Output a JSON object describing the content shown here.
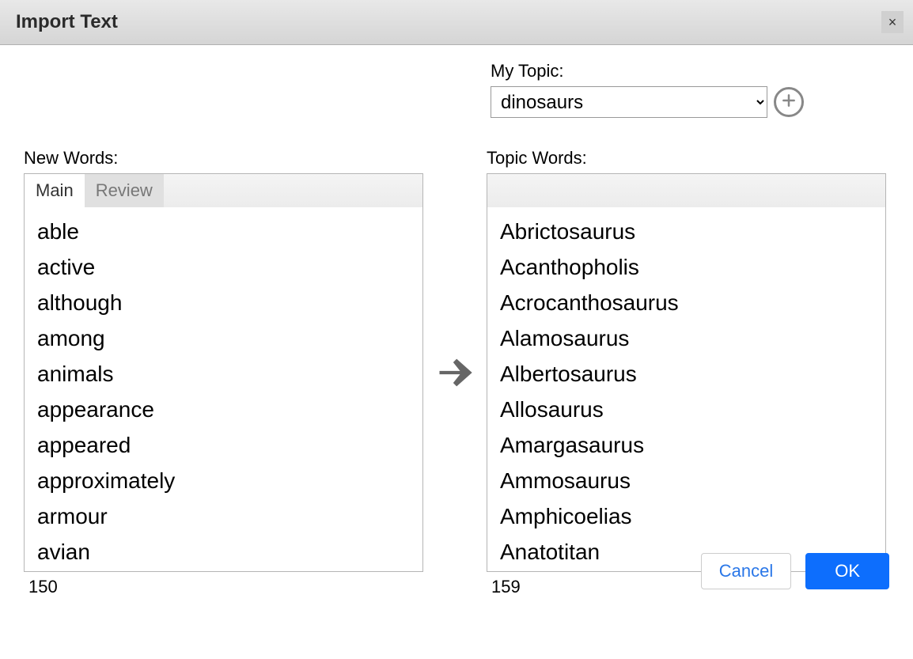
{
  "title": "Import Text",
  "topic": {
    "label": "My Topic:",
    "value": "dinosaurs"
  },
  "newWords": {
    "label": "New Words:",
    "tabs": {
      "main": "Main",
      "review": "Review"
    },
    "items": [
      "able",
      "active",
      "although",
      "among",
      "animals",
      "appearance",
      "appeared",
      "approximately",
      "armour",
      "avian"
    ],
    "count": "150"
  },
  "topicWords": {
    "label": "Topic Words:",
    "items": [
      "Abrictosaurus",
      "Acanthopholis",
      "Acrocanthosaurus",
      "Alamosaurus",
      "Albertosaurus",
      "Allosaurus",
      "Amargasaurus",
      "Ammosaurus",
      "Amphicoelias",
      "Anatotitan"
    ],
    "count": "159"
  },
  "buttons": {
    "cancel": "Cancel",
    "ok": "OK"
  }
}
